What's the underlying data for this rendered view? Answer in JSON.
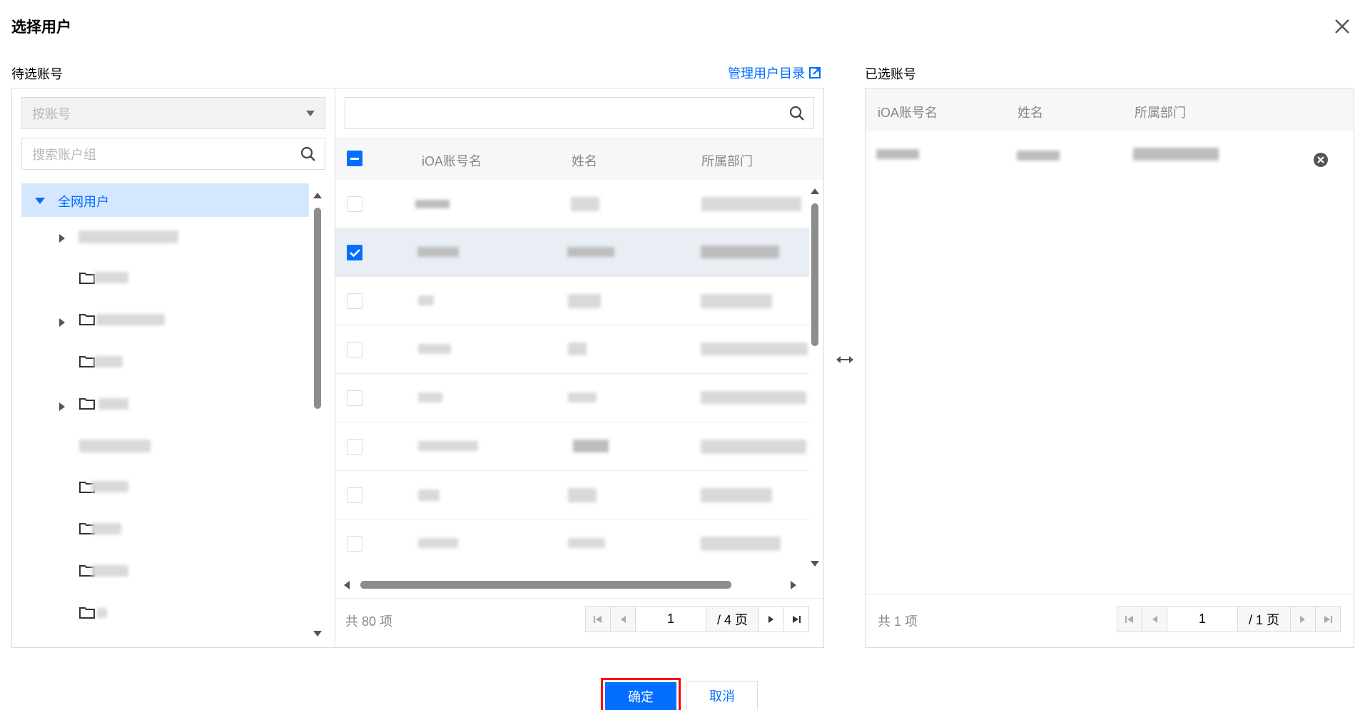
{
  "dialog": {
    "title": "选择用户"
  },
  "left": {
    "label": "待选账号",
    "manage_link": "管理用户目录",
    "dropdown_value": "按账号",
    "group_search_placeholder": "搜索账户组",
    "tree_root": "全网用户",
    "user_search_placeholder": "",
    "columns": [
      "iOA账号名",
      "姓名",
      "所属部门"
    ],
    "total": "共 80 项",
    "page_current": "1",
    "page_total": "/ 4 页"
  },
  "right": {
    "label": "已选账号",
    "columns": [
      "iOA账号名",
      "姓名",
      "所属部门"
    ],
    "total": "共 1 项",
    "page_current": "1",
    "page_total": "/ 1 页"
  },
  "footer": {
    "confirm": "确定",
    "cancel": "取消"
  },
  "colors": {
    "accent": "#006eff",
    "highlight_border": "#ff0000",
    "selected_row": "#e9eef5",
    "tree_selected": "#d5e7ff"
  },
  "icons": [
    "close-icon",
    "external-link-icon",
    "dropdown-arrow-icon",
    "search-icon",
    "caret-down-icon",
    "caret-right-icon",
    "folder-icon",
    "swap-arrows-icon",
    "remove-circle-icon",
    "first-page-icon",
    "prev-page-icon",
    "next-page-icon",
    "last-page-icon"
  ]
}
